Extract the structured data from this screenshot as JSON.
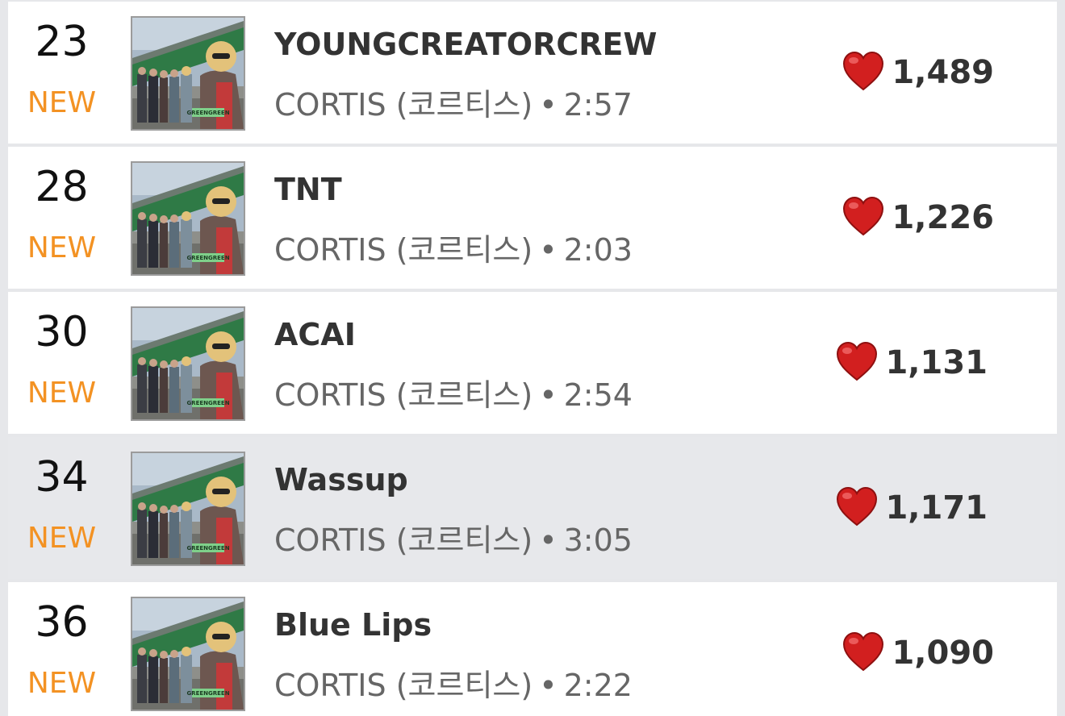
{
  "tracks": [
    {
      "rank": "23",
      "status": "NEW",
      "title": "YOUNGCREATORCREW",
      "artist": "CORTIS (코르티스)",
      "separator": "•",
      "duration": "2:57",
      "likes": "1,489",
      "cover_text": "GREENGREEN"
    },
    {
      "rank": "28",
      "status": "NEW",
      "title": "TNT",
      "artist": "CORTIS (코르티스)",
      "separator": "•",
      "duration": "2:03",
      "likes": "1,226",
      "cover_text": "GREENGREEN"
    },
    {
      "rank": "30",
      "status": "NEW",
      "title": "ACAI",
      "artist": "CORTIS (코르티스)",
      "separator": "•",
      "duration": "2:54",
      "likes": "1,131",
      "cover_text": "GREENGREEN"
    },
    {
      "rank": "34",
      "status": "NEW",
      "title": "Wassup",
      "artist": "CORTIS (코르티스)",
      "separator": "•",
      "duration": "3:05",
      "likes": "1,171",
      "cover_text": "GREENGREEN"
    },
    {
      "rank": "36",
      "status": "NEW",
      "title": "Blue Lips",
      "artist": "CORTIS (코르티스)",
      "separator": "•",
      "duration": "2:22",
      "likes": "1,090",
      "cover_text": "GREENGREEN"
    }
  ],
  "icons": {
    "like": "heart-icon"
  },
  "colors": {
    "new_badge": "#f39223",
    "heart": "#d21f1f",
    "row_highlight": "#e7e8eb"
  }
}
